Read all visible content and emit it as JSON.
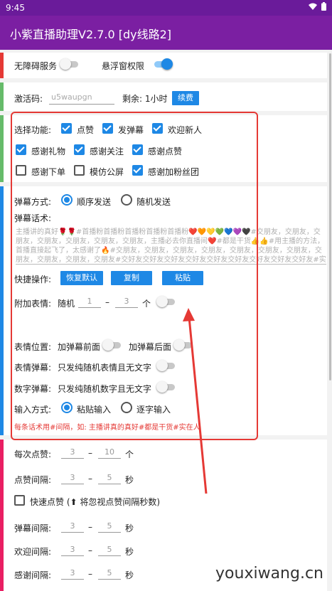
{
  "status_bar": {
    "time": "9:45"
  },
  "app": {
    "title": "小紫直播助理V2.7.0 [dy线路2]"
  },
  "perms": {
    "accessibility_label": "无障碍服务",
    "accessibility_on": false,
    "overlay_label": "悬浮窗权限",
    "overlay_on": true
  },
  "activation": {
    "code_label": "激活码:",
    "code_value": "u5waupgn",
    "remaining_label": "剩余: 1小时",
    "renew_label": "续费"
  },
  "functions": {
    "label": "选择功能:",
    "items": [
      {
        "label": "点赞",
        "checked": true
      },
      {
        "label": "发弹幕",
        "checked": true
      },
      {
        "label": "欢迎新人",
        "checked": true
      },
      {
        "label": "感谢礼物",
        "checked": true
      },
      {
        "label": "感谢关注",
        "checked": true
      },
      {
        "label": "感谢点赞",
        "checked": true
      },
      {
        "label": "感谢下单",
        "checked": false
      },
      {
        "label": "模仿公屏",
        "checked": false
      },
      {
        "label": "感谢加粉丝团",
        "checked": true
      }
    ]
  },
  "danmu": {
    "mode_label": "弹幕方式:",
    "mode_options": [
      "顺序发送",
      "随机发送"
    ],
    "mode_selected": 0,
    "script_label": "弹幕话术:",
    "script_text": "主播讲的真好🌹🌹#首播粉首播粉首播粉首播粉首播粉❤️🧡💛💚💙💜🖤#交朋友，交朋友，交朋友，交朋友，交朋友，交朋友，交朋友，主播必去你直播间❤️#都是干货👍👍#用主播的方法，首播直接起飞了，太感谢了🔥#交朋友，交朋友，交朋友，交朋友，交朋友，交朋友，交朋友，交朋友，交朋友，交朋友，交朋友#交好友交好友交好友交好友交好友交好友交好友交好友交好友#实在人#直播粉",
    "quick_label": "快捷操作:",
    "quick_buttons": [
      "恢复默认",
      "复制",
      "粘贴"
    ],
    "emoji_label": "附加表情:",
    "emoji_random": "随机",
    "emoji_min": "1",
    "dash": "–",
    "emoji_max": "3",
    "emoji_unit": "个",
    "emoji_on": false,
    "emoji_pos_label": "表情位置:",
    "emoji_front_label": "加弹幕前面",
    "emoji_front_on": false,
    "emoji_back_label": "加弹幕后面",
    "emoji_back_on": false,
    "emoji_danmu_label": "表情弹幕:",
    "emoji_danmu_text": "只发纯随机表情且无文字",
    "emoji_danmu_on": false,
    "number_danmu_label": "数字弹幕:",
    "number_danmu_text": "只发纯随机数字且无文字",
    "number_danmu_on": false,
    "input_label": "输入方式:",
    "input_options": [
      "粘贴输入",
      "逐字输入"
    ],
    "input_selected": 0,
    "hint": "每条话术用#间隔，如: 主播讲真的真好#都是干货#实在人"
  },
  "like": {
    "per_label": "每次点赞:",
    "per_min": "3",
    "per_max": "10",
    "per_unit": "个",
    "interval_label": "点赞间隔:",
    "interval_min": "3",
    "interval_max": "5",
    "sec": "秒",
    "fast_label": "快速点赞 (⬆ 将忽视点赞间隔秒数)",
    "fast_checked": false,
    "danmu_interval_label": "弹幕间隔:",
    "danmu_min": "3",
    "danmu_max": "5",
    "welcome_interval_label": "欢迎间隔:",
    "welcome_min": "3",
    "welcome_max": "5",
    "thanks_interval_label": "感谢间隔:",
    "thanks_min": "3",
    "thanks_max": "5"
  },
  "watermark": "youxiwang.cn",
  "colors": {
    "accent": "#1e88e5",
    "appbar": "#7b1fa2",
    "highlight": "#e53935",
    "bar_red": "#e53935",
    "bar_green": "#66bb6a",
    "bar_blue": "#1e88e5",
    "bar_pink": "#e91e63"
  }
}
